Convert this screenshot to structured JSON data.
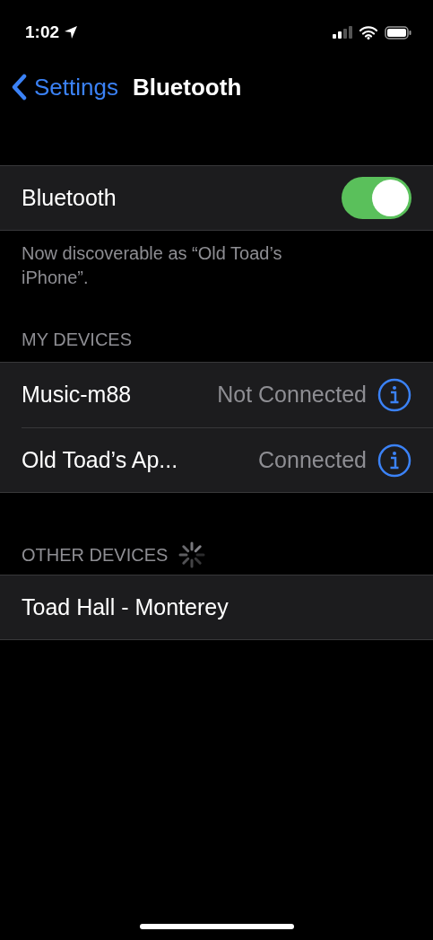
{
  "status_bar": {
    "time": "1:02"
  },
  "nav": {
    "back": "Settings",
    "title": "Bluetooth"
  },
  "bluetooth": {
    "label": "Bluetooth",
    "on": true,
    "footer": "Now discoverable as “Old Toad’s iPhone”."
  },
  "my_devices": {
    "header": "MY DEVICES",
    "items": [
      {
        "name": "Music-m88",
        "status": "Not Connected"
      },
      {
        "name": "Old Toad’s Ap...",
        "status": "Connected"
      }
    ]
  },
  "other_devices": {
    "header": "OTHER DEVICES",
    "scanning": true,
    "items": [
      {
        "name": "Toad Hall - Monterey"
      }
    ]
  }
}
